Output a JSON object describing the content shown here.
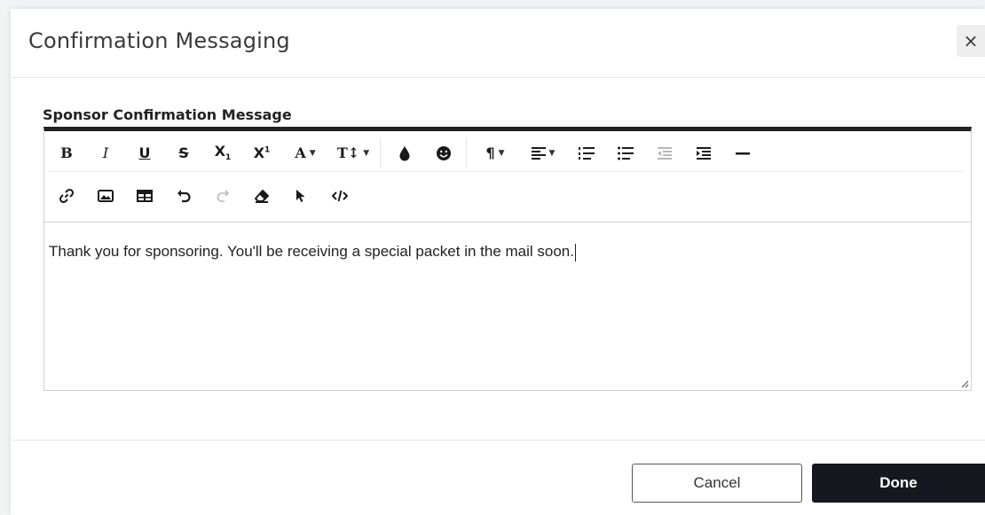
{
  "modal": {
    "title": "Confirmation Messaging",
    "close_label": "×"
  },
  "field": {
    "label": "Sponsor Confirmation Message"
  },
  "toolbar": {
    "bold": "B",
    "italic": "I",
    "underline": "U",
    "strikethrough": "S",
    "subscript": "X",
    "subscript_sub": "1",
    "superscript": "X",
    "superscript_sup": "1",
    "font_family": "A",
    "font_size": "T↕",
    "paragraph": "¶",
    "caret": "▼"
  },
  "editor": {
    "content": "Thank you for sponsoring. You'll be receiving a special packet in the mail soon."
  },
  "footer": {
    "cancel_label": "Cancel",
    "done_label": "Done"
  },
  "colors": {
    "editor_top_border": "#222222",
    "done_background": "#16181f",
    "disabled_icon": "#b8b8b8"
  }
}
